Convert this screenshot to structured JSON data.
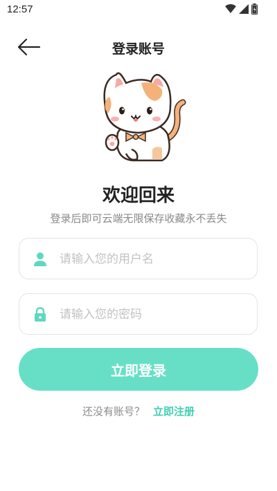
{
  "status_bar": {
    "time": "12:57",
    "icons": [
      "wifi-icon",
      "signal-icon",
      "battery-icon"
    ]
  },
  "header": {
    "back_icon": "arrow-left-icon",
    "title": "登录账号"
  },
  "mascot": {
    "icon": "cat-mascot"
  },
  "welcome": {
    "heading": "欢迎回来",
    "subtitle": "登录后即可云端无限保存收藏永不丢失"
  },
  "form": {
    "username": {
      "icon": "user-icon",
      "placeholder": "请输入您的用户名",
      "value": ""
    },
    "password": {
      "icon": "lock-icon",
      "placeholder": "请输入您的密码",
      "value": ""
    },
    "login_label": "立即登录"
  },
  "register": {
    "prompt": "还没有账号？",
    "link": "立即注册"
  },
  "colors": {
    "accent": "#67dfc6",
    "link": "#3fcfb3",
    "icon": "#5fd8c0"
  }
}
